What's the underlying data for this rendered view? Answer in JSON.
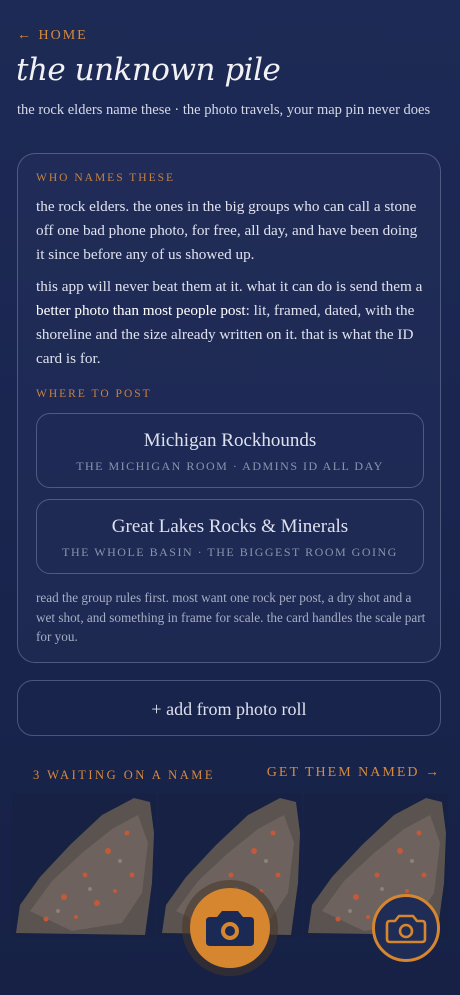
{
  "nav": {
    "back_label": "← HOME"
  },
  "header": {
    "title": "the unknown pile",
    "subtitle": "the rock elders name these · the photo travels, your map pin never does"
  },
  "card": {
    "who_kicker": "WHO NAMES THESE",
    "para1": "the rock elders. the ones in the big groups who can call a stone off one bad phone photo, for free, all day, and have been doing it since before any of us showed up.",
    "para2_start": "this app will never beat them at it. what it can do is send them a ",
    "para2_strong": "better photo than most people post",
    "para2_end": ": lit, framed, dated, with the shoreline and the size already written on it. that is what the ID card is for.",
    "where_kicker": "WHERE TO POST",
    "groups": [
      {
        "name": "Michigan Rockhounds",
        "sub": "THE MICHIGAN ROOM · ADMINS ID ALL DAY"
      },
      {
        "name": "Great Lakes Rocks & Minerals",
        "sub": "THE WHOLE BASIN · THE BIGGEST ROOM GOING"
      }
    ],
    "note": "read the group rules first. most want one rock per post, a dry shot and a wet shot, and something in frame for scale. the card handles the scale part for you."
  },
  "add_button": "+ add from photo roll",
  "queue": {
    "waiting_label": "3 WAITING ON A NAME",
    "action_label": "GET THEM NAMED →",
    "photos": [
      "rock-photo",
      "rock-photo",
      "rock-photo"
    ]
  },
  "fab": {
    "primary_icon": "camera-icon",
    "secondary_icon": "camera-icon"
  },
  "colors": {
    "accent": "#d6862f",
    "background": "#1c2852",
    "text": "#e6e8f0"
  }
}
